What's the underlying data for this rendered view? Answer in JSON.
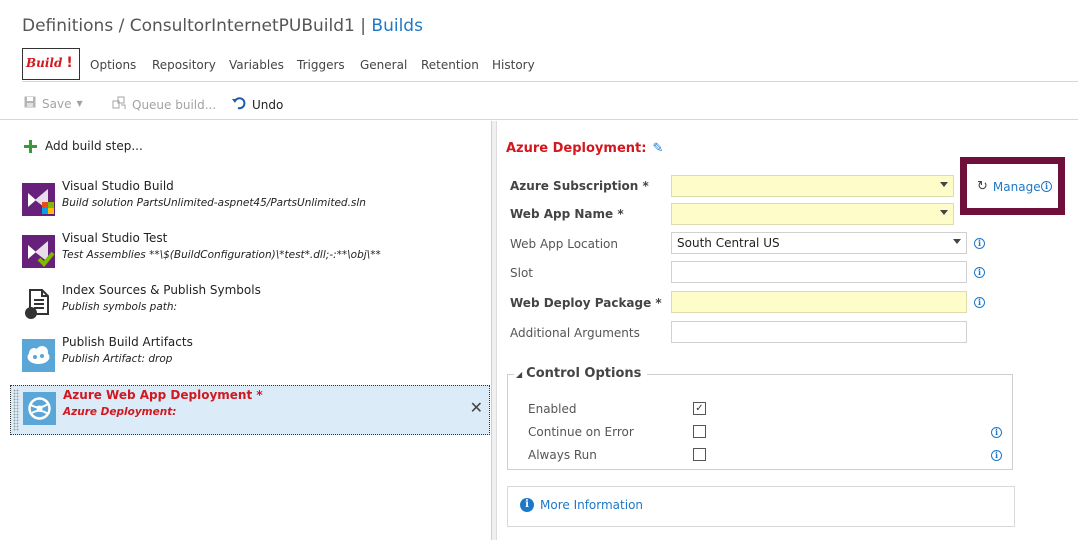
{
  "header": {
    "path": "Definitions / ConsultorInternetPUBuild1",
    "separator": "|",
    "builds_link": "Builds"
  },
  "tabs": [
    {
      "label": "Build",
      "badge": "!"
    },
    {
      "label": "Options"
    },
    {
      "label": "Repository"
    },
    {
      "label": "Variables"
    },
    {
      "label": "Triggers"
    },
    {
      "label": "General"
    },
    {
      "label": "Retention"
    },
    {
      "label": "History"
    }
  ],
  "toolbar": {
    "save_label": "Save",
    "queue_label": "Queue build...",
    "undo_label": "Undo"
  },
  "steps_panel": {
    "add_label": "Add build step...",
    "steps": [
      {
        "name": "Visual Studio Build",
        "desc": "Build solution PartsUnlimited-aspnet45/PartsUnlimited.sln"
      },
      {
        "name": "Visual Studio Test",
        "desc": "Test Assemblies **\\$(BuildConfiguration)\\*test*.dll;-:**\\obj\\**"
      },
      {
        "name": "Index Sources & Publish Symbols",
        "desc": "Publish symbols path:"
      },
      {
        "name": "Publish Build Artifacts",
        "desc": "Publish Artifact: drop"
      },
      {
        "name": "Azure Web App Deployment *",
        "desc": "Azure Deployment:"
      }
    ]
  },
  "details": {
    "title": "Azure Deployment:",
    "fields": {
      "subscription_label": "Azure Subscription *",
      "subscription_value": "",
      "webapp_name_label": "Web App Name *",
      "webapp_name_value": "",
      "location_label": "Web App Location",
      "location_value": "South Central US",
      "slot_label": "Slot",
      "slot_value": "",
      "package_label": "Web Deploy Package *",
      "package_value": "",
      "args_label": "Additional Arguments",
      "args_value": ""
    },
    "manage_label": "Manage",
    "control_options": {
      "title": "Control Options",
      "enabled_label": "Enabled",
      "enabled": true,
      "continue_label": "Continue on Error",
      "continue": false,
      "always_run_label": "Always Run",
      "always_run": false
    },
    "more_info_label": "More Information"
  },
  "colors": {
    "accent_blue": "#1e78c8",
    "error_red": "#d2171e",
    "required_yellow": "#fefcc8",
    "highlight_maroon": "#6e0f3c",
    "selected_row": "#dcebf8"
  }
}
